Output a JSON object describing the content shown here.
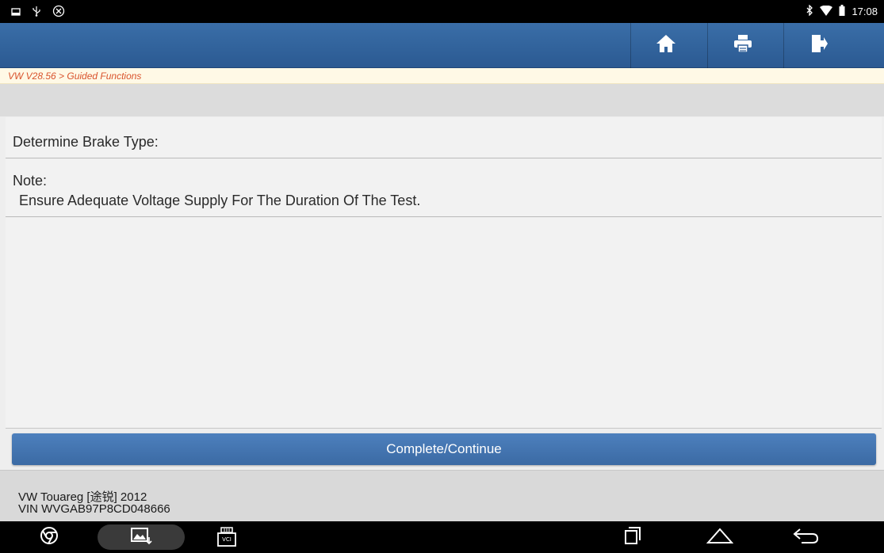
{
  "statusbar": {
    "time": "17:08",
    "left_icons": [
      "screenshot-icon",
      "usb-icon",
      "app-notification-icon"
    ],
    "right_icons": [
      "bluetooth-icon",
      "wifi-icon",
      "battery-icon"
    ]
  },
  "appbar": {
    "buttons": [
      "home-icon",
      "print-icon",
      "exit-icon"
    ],
    "color": "#2f5f98"
  },
  "breadcrumb": {
    "text": "VW V28.56 > Guided Functions",
    "color": "#d9532c"
  },
  "content": {
    "title": "Determine Brake Type:",
    "note_label": "Note:",
    "note_text": "Ensure Adequate Voltage Supply For The Duration Of The Test."
  },
  "action": {
    "label": "Complete/Continue"
  },
  "vehicle": {
    "model": "VW Touareg [途锐] 2012",
    "vin": "VIN WVGAB97P8CD048666"
  },
  "navbar": {
    "left": [
      "chrome-icon",
      "gallery-icon",
      "vci-icon"
    ],
    "right": [
      "recent-apps-icon",
      "home-nav-icon",
      "back-icon"
    ],
    "vci_label": "VCI"
  }
}
